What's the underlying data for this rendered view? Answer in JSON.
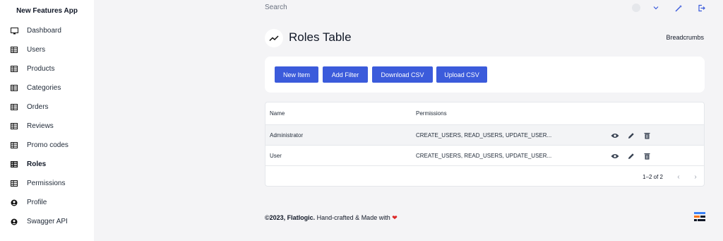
{
  "app": {
    "title": "New Features App"
  },
  "sidebar": {
    "items": [
      {
        "label": "Dashboard",
        "icon": "monitor-icon"
      },
      {
        "label": "Users",
        "icon": "table-icon"
      },
      {
        "label": "Products",
        "icon": "table-icon"
      },
      {
        "label": "Categories",
        "icon": "table-icon"
      },
      {
        "label": "Orders",
        "icon": "table-icon"
      },
      {
        "label": "Reviews",
        "icon": "table-icon"
      },
      {
        "label": "Promo codes",
        "icon": "table-icon"
      },
      {
        "label": "Roles",
        "icon": "table-icon",
        "active": true
      },
      {
        "label": "Permissions",
        "icon": "table-icon"
      },
      {
        "label": "Profile",
        "icon": "user-circle-icon"
      },
      {
        "label": "Swagger API",
        "icon": "user-circle-icon"
      }
    ]
  },
  "topbar": {
    "search_placeholder": "Search"
  },
  "header": {
    "title": "Roles Table",
    "breadcrumbs": "Breadcrumbs"
  },
  "toolbar": {
    "new_item": "New Item",
    "add_filter": "Add Filter",
    "download_csv": "Download CSV",
    "upload_csv": "Upload CSV"
  },
  "table": {
    "columns": [
      "Name",
      "Permissions"
    ],
    "rows": [
      {
        "name": "Administrator",
        "permissions": "CREATE_USERS, READ_USERS, UPDATE_USER..."
      },
      {
        "name": "User",
        "permissions": "CREATE_USERS, READ_USERS, UPDATE_USER..."
      }
    ],
    "pagination": "1–2 of 2"
  },
  "footer": {
    "brand": "©2023, Flatlogic.",
    "text": " Hand-crafted & Made with ",
    "heart": "❤"
  },
  "colors": {
    "primary": "#3b5bdb",
    "background": "#f4f4f6",
    "heart": "#dc2626"
  }
}
